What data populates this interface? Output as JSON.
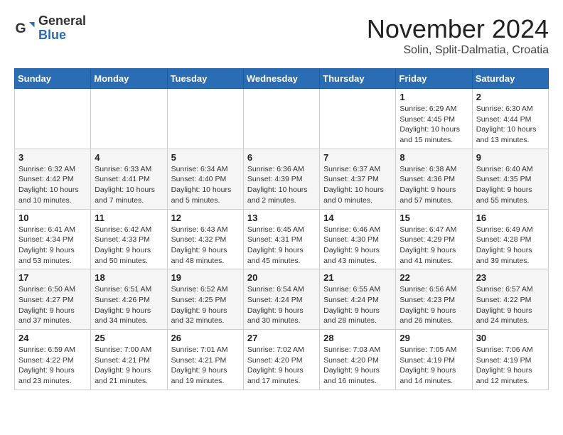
{
  "header": {
    "logo_general": "General",
    "logo_blue": "Blue",
    "month_title": "November 2024",
    "subtitle": "Solin, Split-Dalmatia, Croatia"
  },
  "days_of_week": [
    "Sunday",
    "Monday",
    "Tuesday",
    "Wednesday",
    "Thursday",
    "Friday",
    "Saturday"
  ],
  "weeks": [
    [
      {
        "day": "",
        "info": ""
      },
      {
        "day": "",
        "info": ""
      },
      {
        "day": "",
        "info": ""
      },
      {
        "day": "",
        "info": ""
      },
      {
        "day": "",
        "info": ""
      },
      {
        "day": "1",
        "info": "Sunrise: 6:29 AM\nSunset: 4:45 PM\nDaylight: 10 hours\nand 15 minutes."
      },
      {
        "day": "2",
        "info": "Sunrise: 6:30 AM\nSunset: 4:44 PM\nDaylight: 10 hours\nand 13 minutes."
      }
    ],
    [
      {
        "day": "3",
        "info": "Sunrise: 6:32 AM\nSunset: 4:42 PM\nDaylight: 10 hours\nand 10 minutes."
      },
      {
        "day": "4",
        "info": "Sunrise: 6:33 AM\nSunset: 4:41 PM\nDaylight: 10 hours\nand 7 minutes."
      },
      {
        "day": "5",
        "info": "Sunrise: 6:34 AM\nSunset: 4:40 PM\nDaylight: 10 hours\nand 5 minutes."
      },
      {
        "day": "6",
        "info": "Sunrise: 6:36 AM\nSunset: 4:39 PM\nDaylight: 10 hours\nand 2 minutes."
      },
      {
        "day": "7",
        "info": "Sunrise: 6:37 AM\nSunset: 4:37 PM\nDaylight: 10 hours\nand 0 minutes."
      },
      {
        "day": "8",
        "info": "Sunrise: 6:38 AM\nSunset: 4:36 PM\nDaylight: 9 hours\nand 57 minutes."
      },
      {
        "day": "9",
        "info": "Sunrise: 6:40 AM\nSunset: 4:35 PM\nDaylight: 9 hours\nand 55 minutes."
      }
    ],
    [
      {
        "day": "10",
        "info": "Sunrise: 6:41 AM\nSunset: 4:34 PM\nDaylight: 9 hours\nand 53 minutes."
      },
      {
        "day": "11",
        "info": "Sunrise: 6:42 AM\nSunset: 4:33 PM\nDaylight: 9 hours\nand 50 minutes."
      },
      {
        "day": "12",
        "info": "Sunrise: 6:43 AM\nSunset: 4:32 PM\nDaylight: 9 hours\nand 48 minutes."
      },
      {
        "day": "13",
        "info": "Sunrise: 6:45 AM\nSunset: 4:31 PM\nDaylight: 9 hours\nand 45 minutes."
      },
      {
        "day": "14",
        "info": "Sunrise: 6:46 AM\nSunset: 4:30 PM\nDaylight: 9 hours\nand 43 minutes."
      },
      {
        "day": "15",
        "info": "Sunrise: 6:47 AM\nSunset: 4:29 PM\nDaylight: 9 hours\nand 41 minutes."
      },
      {
        "day": "16",
        "info": "Sunrise: 6:49 AM\nSunset: 4:28 PM\nDaylight: 9 hours\nand 39 minutes."
      }
    ],
    [
      {
        "day": "17",
        "info": "Sunrise: 6:50 AM\nSunset: 4:27 PM\nDaylight: 9 hours\nand 37 minutes."
      },
      {
        "day": "18",
        "info": "Sunrise: 6:51 AM\nSunset: 4:26 PM\nDaylight: 9 hours\nand 34 minutes."
      },
      {
        "day": "19",
        "info": "Sunrise: 6:52 AM\nSunset: 4:25 PM\nDaylight: 9 hours\nand 32 minutes."
      },
      {
        "day": "20",
        "info": "Sunrise: 6:54 AM\nSunset: 4:24 PM\nDaylight: 9 hours\nand 30 minutes."
      },
      {
        "day": "21",
        "info": "Sunrise: 6:55 AM\nSunset: 4:24 PM\nDaylight: 9 hours\nand 28 minutes."
      },
      {
        "day": "22",
        "info": "Sunrise: 6:56 AM\nSunset: 4:23 PM\nDaylight: 9 hours\nand 26 minutes."
      },
      {
        "day": "23",
        "info": "Sunrise: 6:57 AM\nSunset: 4:22 PM\nDaylight: 9 hours\nand 24 minutes."
      }
    ],
    [
      {
        "day": "24",
        "info": "Sunrise: 6:59 AM\nSunset: 4:22 PM\nDaylight: 9 hours\nand 23 minutes."
      },
      {
        "day": "25",
        "info": "Sunrise: 7:00 AM\nSunset: 4:21 PM\nDaylight: 9 hours\nand 21 minutes."
      },
      {
        "day": "26",
        "info": "Sunrise: 7:01 AM\nSunset: 4:21 PM\nDaylight: 9 hours\nand 19 minutes."
      },
      {
        "day": "27",
        "info": "Sunrise: 7:02 AM\nSunset: 4:20 PM\nDaylight: 9 hours\nand 17 minutes."
      },
      {
        "day": "28",
        "info": "Sunrise: 7:03 AM\nSunset: 4:20 PM\nDaylight: 9 hours\nand 16 minutes."
      },
      {
        "day": "29",
        "info": "Sunrise: 7:05 AM\nSunset: 4:19 PM\nDaylight: 9 hours\nand 14 minutes."
      },
      {
        "day": "30",
        "info": "Sunrise: 7:06 AM\nSunset: 4:19 PM\nDaylight: 9 hours\nand 12 minutes."
      }
    ]
  ]
}
